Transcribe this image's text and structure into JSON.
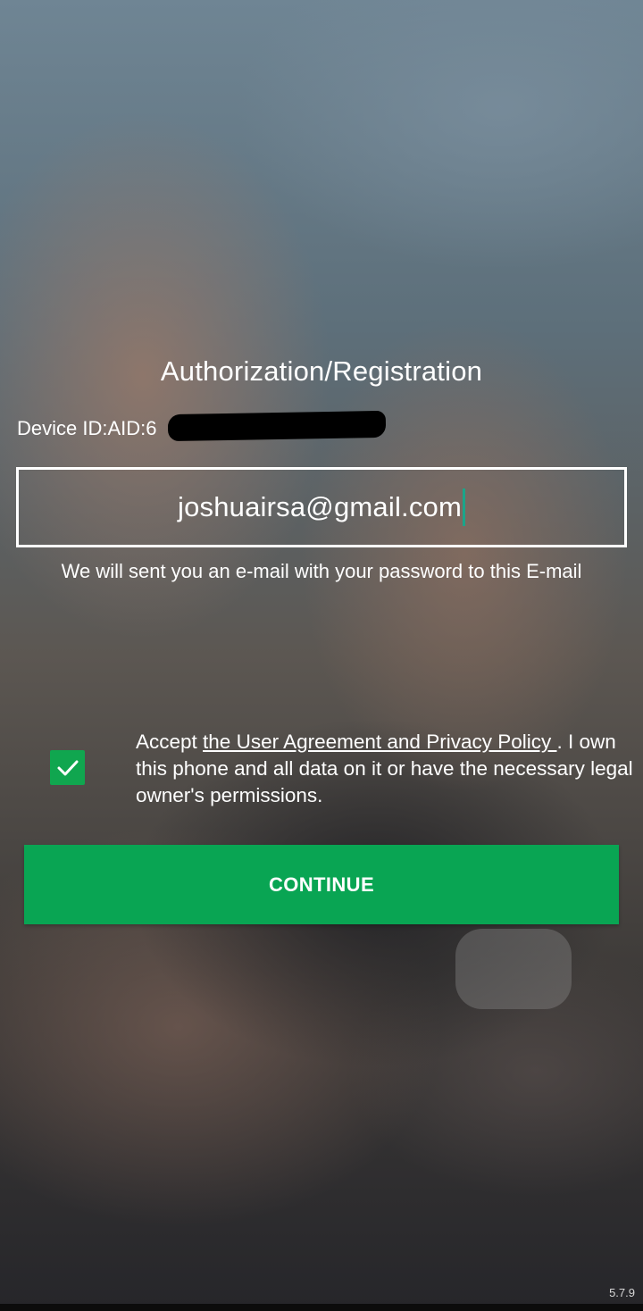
{
  "screen": {
    "title": "Authorization/Registration",
    "device_id_label": "Device ID:AID:",
    "device_id_visible": "6",
    "email_value": "joshuairsa@gmail.com",
    "email_hint": "We will sent you an e-mail with your password to this E-mail",
    "agreement": {
      "checked": true,
      "prefix": "Accept ",
      "link_text": "the User Agreement and Privacy Policy ",
      "suffix": ". I own this phone and all data on it or have the necessary legal owner's permissions."
    },
    "continue_label": "CONTINUE",
    "version": "5.7.9"
  },
  "colors": {
    "accent_green": "#09a553",
    "checkbox_green": "#10a64f",
    "caret": "#1aa58a"
  },
  "icons": {
    "checkbox": "checkmark-icon"
  }
}
